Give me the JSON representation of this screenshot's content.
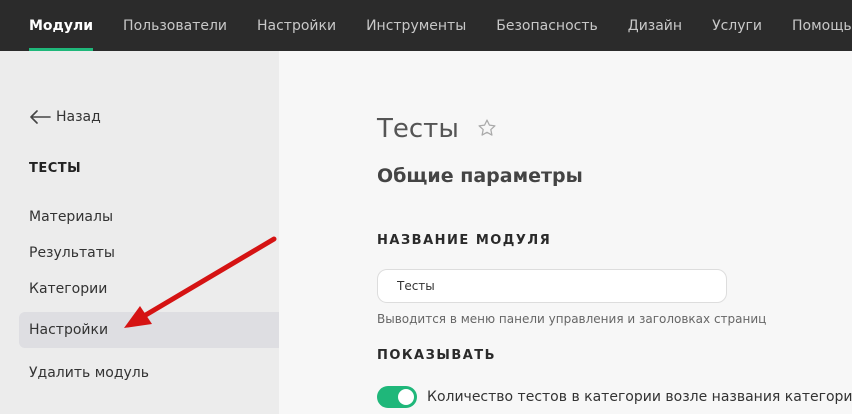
{
  "topnav": {
    "items": [
      "Модули",
      "Пользователи",
      "Настройки",
      "Инструменты",
      "Безопасность",
      "Дизайн",
      "Услуги",
      "Помощь"
    ]
  },
  "sidebar": {
    "back_label": "Назад",
    "section_title": "ТЕСТЫ",
    "items": [
      "Материалы",
      "Результаты",
      "Категории",
      "Настройки",
      "Удалить модуль"
    ]
  },
  "main": {
    "title": "Тесты",
    "subheading": "Общие параметры",
    "module_name_label": "НАЗВАНИЕ МОДУЛЯ",
    "module_name_value": "Тесты",
    "module_name_hint": "Выводится в меню панели управления и заголовках страниц",
    "show_label": "ПОКАЗЫВАТЬ",
    "toggle_label": "Количество тестов в категории возле названия категории"
  },
  "colors": {
    "accent": "#1fb77a",
    "annotation_arrow": "#d51313",
    "topnav_bg": "#2b2b2b"
  }
}
